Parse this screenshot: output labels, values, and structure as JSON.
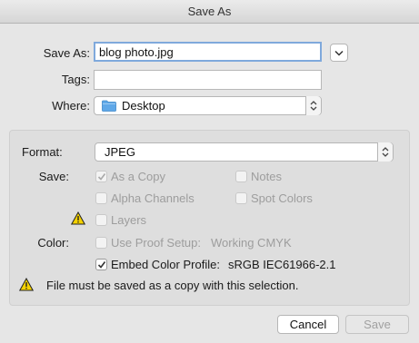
{
  "window": {
    "title": "Save As"
  },
  "form": {
    "save_as_label": "Save As:",
    "filename": "blog photo.jpg",
    "tags_label": "Tags:",
    "tags_value": "",
    "where_label": "Where:",
    "where_value": "Desktop",
    "where_icon": "folder-icon"
  },
  "options": {
    "format_label": "Format:",
    "format_value": "JPEG",
    "save_label": "Save:",
    "color_label": "Color:",
    "checkboxes": {
      "as_copy": {
        "label": "As a Copy",
        "checked": true,
        "enabled": false
      },
      "notes": {
        "label": "Notes",
        "checked": false,
        "enabled": false
      },
      "alpha": {
        "label": "Alpha Channels",
        "checked": false,
        "enabled": false
      },
      "spot": {
        "label": "Spot Colors",
        "checked": false,
        "enabled": false
      },
      "layers": {
        "label": "Layers",
        "checked": false,
        "enabled": false
      },
      "proof": {
        "label": "Use Proof Setup:",
        "value": "Working CMYK",
        "checked": false,
        "enabled": false
      },
      "embed": {
        "label": "Embed Color Profile:",
        "value": "sRGB IEC61966-2.1",
        "checked": true,
        "enabled": true
      }
    },
    "warning_text": "File must be saved as a copy with this selection."
  },
  "buttons": {
    "cancel": "Cancel",
    "save": "Save"
  },
  "colors": {
    "warning": "#f5d200",
    "focus_ring": "#7fa9dc",
    "folder": "#5fa8e8"
  }
}
